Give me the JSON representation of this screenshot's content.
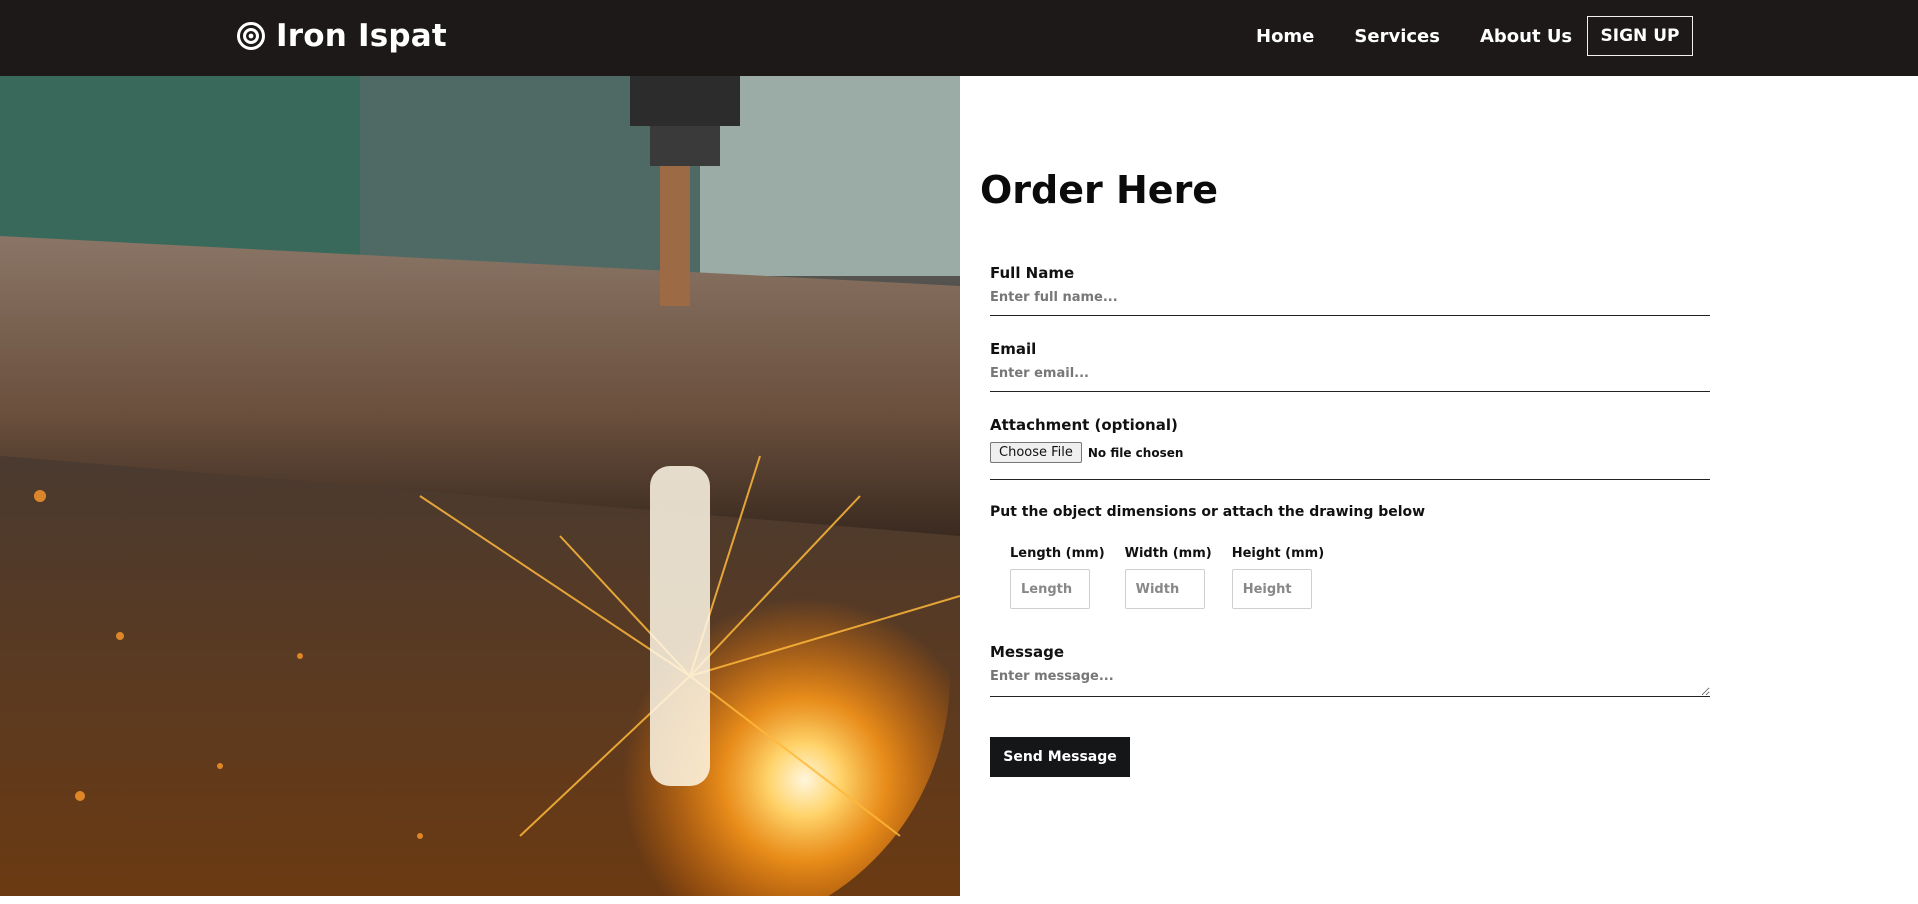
{
  "header": {
    "brand": "Iron Ispat",
    "brand_icon": "target-icon",
    "nav": [
      "Home",
      "Services",
      "About Us"
    ],
    "signup_label": "SIGN UP",
    "bg_color": "#1c1918"
  },
  "hero": {
    "image_subject": "metal-cutting-sparks-image"
  },
  "form": {
    "title": "Order Here",
    "full_name": {
      "label": "Full Name",
      "placeholder": "Enter full name..."
    },
    "email": {
      "label": "Email",
      "placeholder": "Enter email..."
    },
    "attachment": {
      "label": "Attachment (optional)",
      "button": "Choose File",
      "status": "No file chosen"
    },
    "dimensions_hint": "Put the object dimensions or attach the drawing below",
    "dimensions": [
      {
        "label": "Length (mm)",
        "placeholder": "Length"
      },
      {
        "label": "Width (mm)",
        "placeholder": "Width"
      },
      {
        "label": "Height (mm)",
        "placeholder": "Height"
      }
    ],
    "message": {
      "label": "Message",
      "placeholder": "Enter message..."
    },
    "submit_label": "Send Message"
  }
}
